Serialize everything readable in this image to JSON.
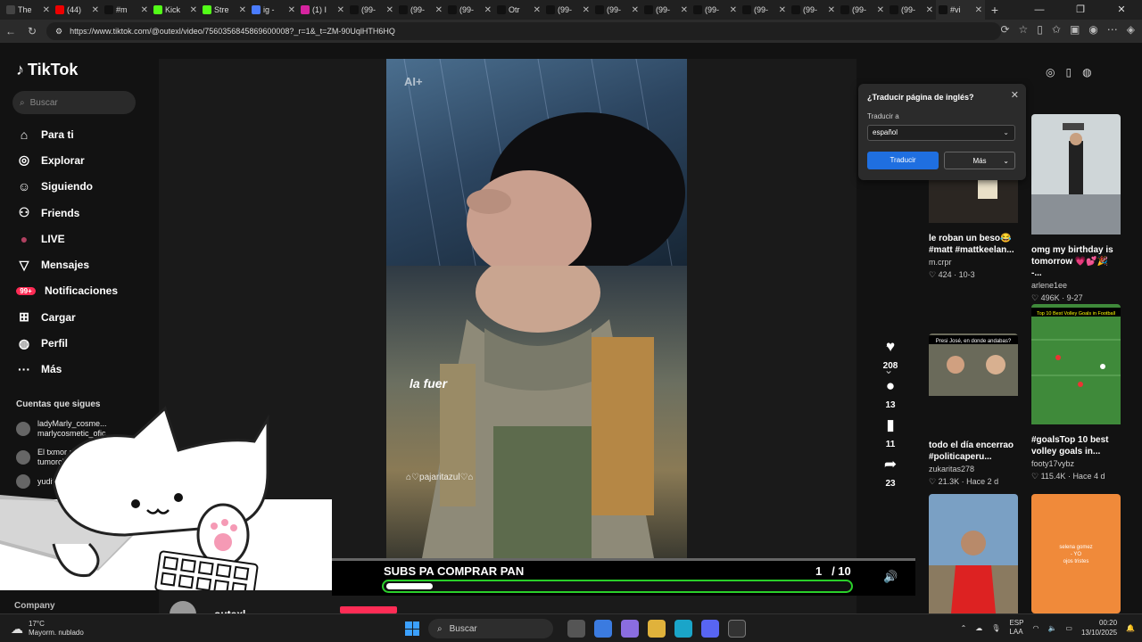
{
  "browser": {
    "tabs": [
      {
        "title": "The",
        "color": "#444"
      },
      {
        "title": "(44)",
        "color": "#e00"
      },
      {
        "title": "#m",
        "color": "#111"
      },
      {
        "title": "Kick",
        "color": "#53fc18"
      },
      {
        "title": "Stre",
        "color": "#53fc18"
      },
      {
        "title": "ig -",
        "color": "#4a7cff"
      },
      {
        "title": "(1) I",
        "color": "#d6249f"
      },
      {
        "title": "(99-",
        "color": "#111"
      },
      {
        "title": "(99-",
        "color": "#111"
      },
      {
        "title": "(99-",
        "color": "#111"
      },
      {
        "title": "Otr",
        "color": "#111"
      },
      {
        "title": "(99-",
        "color": "#111"
      },
      {
        "title": "(99-",
        "color": "#111"
      },
      {
        "title": "(99-",
        "color": "#111"
      },
      {
        "title": "(99-",
        "color": "#111"
      },
      {
        "title": "(99-",
        "color": "#111"
      },
      {
        "title": "(99-",
        "color": "#111"
      },
      {
        "title": "(99-",
        "color": "#111"
      },
      {
        "title": "(99-",
        "color": "#111"
      },
      {
        "title": "#vi",
        "color": "#111"
      }
    ],
    "url": "https://www.tiktok.com/@outexl/video/7560356845869600008?_r=1&_t=ZM-90UqlHTH6HQ"
  },
  "tiktok": {
    "logo": "TikTok",
    "search_placeholder": "Buscar",
    "menu": [
      {
        "label": "Para ti",
        "icon": "home-icon",
        "glyph": "⌂"
      },
      {
        "label": "Explorar",
        "icon": "compass-icon",
        "glyph": "◎"
      },
      {
        "label": "Siguiendo",
        "icon": "following-icon",
        "glyph": "☺"
      },
      {
        "label": "Friends",
        "icon": "friends-icon",
        "glyph": "⚇"
      },
      {
        "label": "LIVE",
        "icon": "live-icon",
        "glyph": "●"
      },
      {
        "label": "Mensajes",
        "icon": "inbox-icon",
        "glyph": "▽"
      },
      {
        "label": "Notificaciones",
        "icon": "bell-icon",
        "glyph": "99+"
      },
      {
        "label": "Cargar",
        "icon": "upload-icon",
        "glyph": "⊞"
      },
      {
        "label": "Perfil",
        "icon": "profile-icon",
        "glyph": "◍"
      },
      {
        "label": "Más",
        "icon": "more-icon",
        "glyph": "···"
      }
    ],
    "following_title": "Cuentas que sigues",
    "following": [
      {
        "line1": "ladyMarly_cosme...",
        "line2": "marlycosmetic_ofic"
      },
      {
        "line1": "El txmor de M",
        "line2": "tumorclips"
      },
      {
        "line1": "yudit",
        "line2": ""
      }
    ],
    "company_label": "Company",
    "video": {
      "watermark": "AI+",
      "caption": "la fuer",
      "credit": "⌂♡pajaritazul♡⌂"
    },
    "actions": {
      "likes": "208",
      "comments": "13",
      "saves": "11",
      "shares": "23"
    },
    "goal": {
      "label": "SUBS PA COMPRAR PAN",
      "current": "1",
      "total": "/ 10",
      "progress": 0.1
    },
    "author_partial": "outexl",
    "recommended": [
      {
        "title": "le roban un beso😂 #matt #mattkeelan...",
        "author": "m.crpr",
        "likes": "424",
        "date": "10-3"
      },
      {
        "title": "omg my birthday is tomorrow 💗💕🎉 -...",
        "author": "arlene1ee",
        "likes": "496K",
        "date": "9-27"
      },
      {
        "title": "todo el día encerrao #politicaperu...",
        "author": "zukaritas278",
        "likes": "21.3K",
        "date": "Hace 2 d"
      },
      {
        "title": "#goalsTop 10 best volley goals in...",
        "author": "footy17vybz",
        "likes": "115.4K",
        "date": "Hace 4 d"
      }
    ],
    "thumb_texts": {
      "thumb3": "Presi José, en donde andabas?",
      "thumb4": "Top 10 Best Volley Goals in Football",
      "thumb6": "selena gomez\n- YO\nojos tristes"
    }
  },
  "translate_popup": {
    "title": "¿Traducir página de inglés?",
    "target_label": "Traducir a",
    "target_value": "español",
    "translate_button": "Traducir",
    "more_button": "Más"
  },
  "taskbar": {
    "temp": "17°C",
    "weather": "Mayorm. nublado",
    "search": "Buscar",
    "lang1": "ESP",
    "lang2": "LAA",
    "time": "00:20",
    "date": "13/10/2025"
  }
}
